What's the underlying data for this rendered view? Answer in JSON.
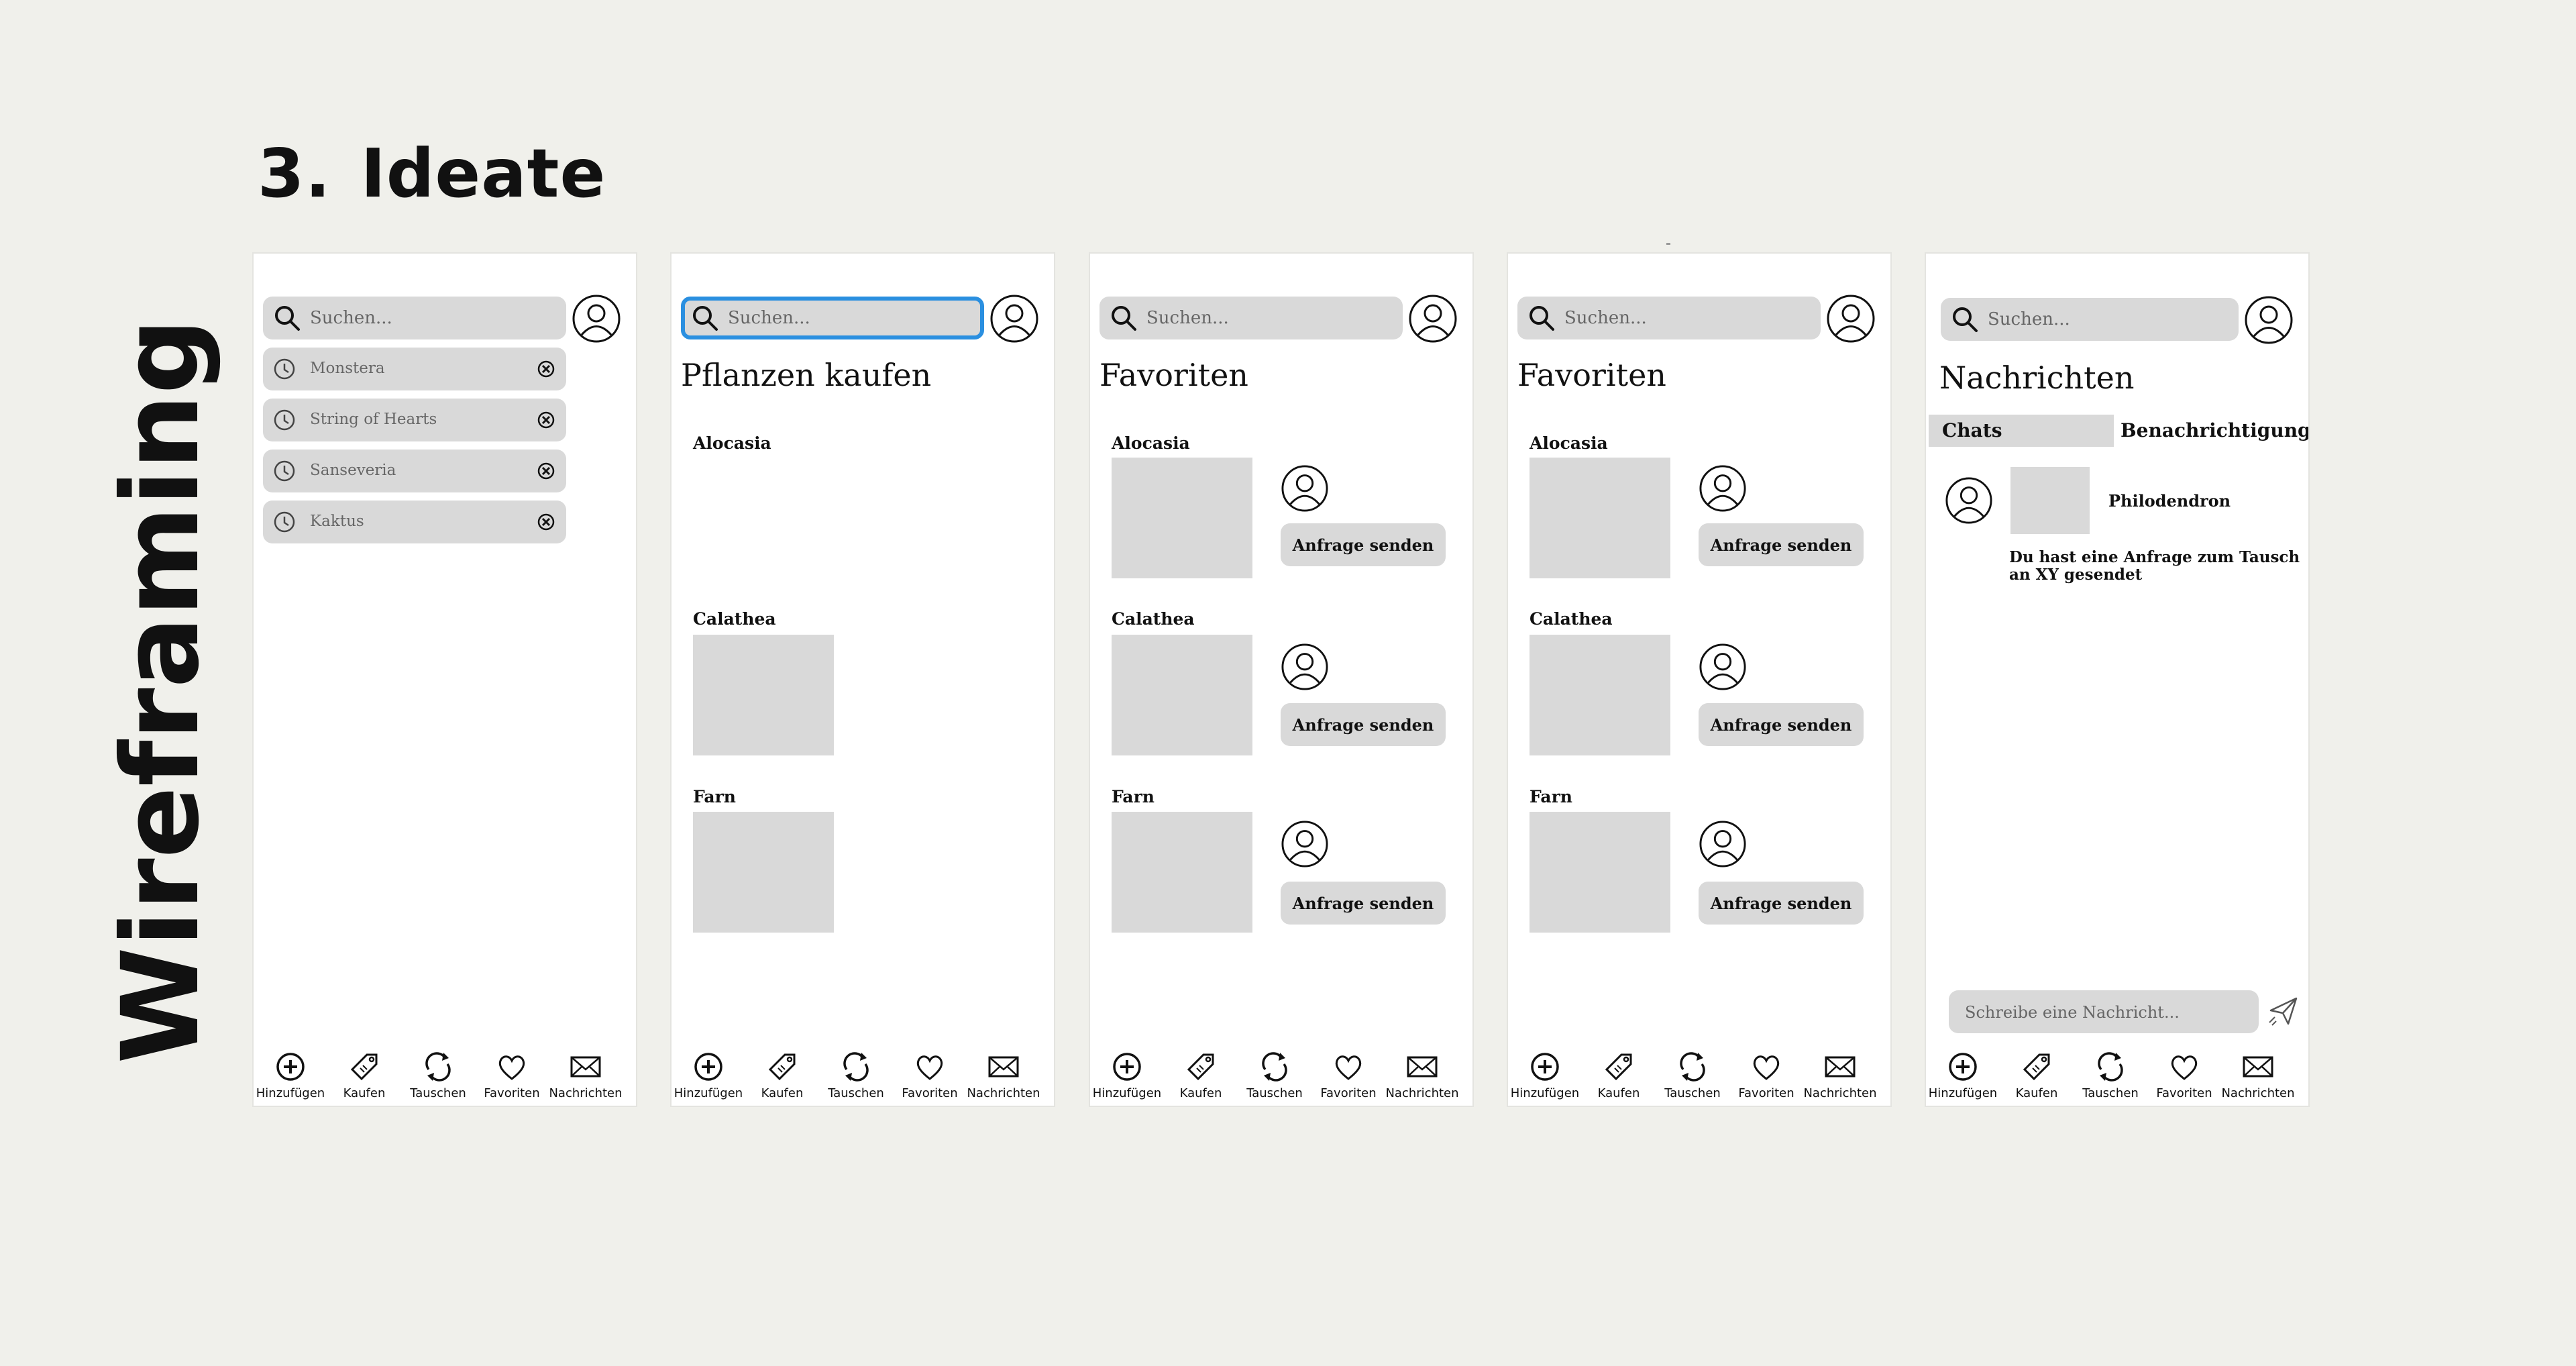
{
  "heading": {
    "number": "3.",
    "text": "Ideate"
  },
  "side_label": "Wireframing",
  "search_placeholder": "Suchen...",
  "screen1": {
    "history": [
      "Monstera",
      "String of Hearts",
      "Sanseveria",
      "Kaktus"
    ]
  },
  "screen2": {
    "title": "Pflanzen kaufen",
    "plants": [
      "Alocasia",
      "Calathea",
      "Farn"
    ]
  },
  "screen3": {
    "title": "Favoriten",
    "plants": [
      "Alocasia",
      "Calathea",
      "Farn"
    ],
    "button": "Anfrage senden"
  },
  "screen4": {
    "title": "Favoriten",
    "plants": [
      "Alocasia",
      "Calathea",
      "Farn"
    ],
    "button": "Anfrage senden"
  },
  "screen5": {
    "title": "Nachrichten",
    "tab_chats": "Chats",
    "tab_notifications": "Benachrichtigungen",
    "chat_name": "Philodendron",
    "chat_message": "Du hast eine Anfrage zum Tausch an XY gesendet",
    "composer_placeholder": "Schreibe eine Nachricht..."
  },
  "nav": [
    {
      "label": "Hinzufügen",
      "icon": "plus-circle-icon"
    },
    {
      "label": "Kaufen",
      "icon": "price-tag-icon"
    },
    {
      "label": "Tauschen",
      "icon": "swap-arrows-icon"
    },
    {
      "label": "Favoriten",
      "icon": "heart-icon"
    },
    {
      "label": "Nachrichten",
      "icon": "envelope-icon"
    }
  ]
}
